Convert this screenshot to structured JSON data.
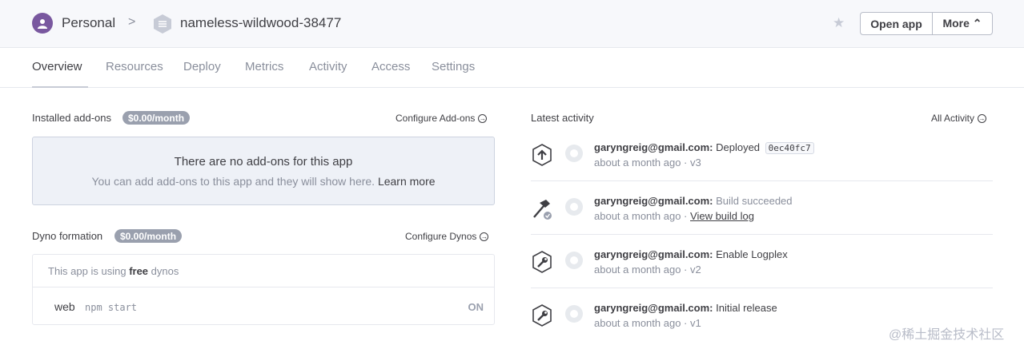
{
  "breadcrumb": {
    "personal": "Personal",
    "separator": ">",
    "app_name": "nameless-wildwood-38477"
  },
  "header_buttons": {
    "open_app": "Open app",
    "more": "More ⌃",
    "star_icon": "star-icon"
  },
  "tabs": [
    {
      "label": "Overview",
      "active": true
    },
    {
      "label": "Resources"
    },
    {
      "label": "Deploy"
    },
    {
      "label": "Metrics"
    },
    {
      "label": "Activity"
    },
    {
      "label": "Access"
    },
    {
      "label": "Settings"
    }
  ],
  "addons": {
    "title": "Installed add-ons",
    "price": "$0.00/month",
    "configure_label": "Configure Add-ons",
    "empty_title": "There are no add-ons for this app",
    "empty_sub": "You can add add-ons to this app and they will show here.",
    "learn_more": "Learn more"
  },
  "dynos": {
    "title": "Dyno formation",
    "price": "$0.00/month",
    "configure_label": "Configure Dynos",
    "free_text_prefix": "This app is using",
    "free_word": "free",
    "free_text_suffix": "dynos",
    "type": "web",
    "command": "npm start",
    "state": "ON"
  },
  "activity": {
    "title": "Latest activity",
    "all_label": "All Activity",
    "items": [
      {
        "icon": "deploy-icon",
        "user": "garyngreig@gmail.com:",
        "action": "Deployed",
        "commit": "0ec40fc7",
        "time": "about a month ago",
        "meta": "· v3"
      },
      {
        "icon": "build-icon",
        "user": "garyngreig@gmail.com:",
        "action": "Build succeeded",
        "time": "about a month ago",
        "meta": "·",
        "link": "View build log"
      },
      {
        "icon": "wrench-icon",
        "user": "garyngreig@gmail.com:",
        "action": "Enable Logplex",
        "time": "about a month ago",
        "meta": "· v2"
      },
      {
        "icon": "wrench-icon",
        "user": "garyngreig@gmail.com:",
        "action": "Initial release",
        "time": "about a month ago",
        "meta": "· v1"
      }
    ]
  },
  "watermark": "@稀土掘金技术社区",
  "colors": {
    "brand_purple": "#79589f",
    "text": "#3f3f44",
    "muted": "#8a8f9c",
    "pill": "#9aa0ae",
    "empty_bg": "#eef1f7"
  }
}
